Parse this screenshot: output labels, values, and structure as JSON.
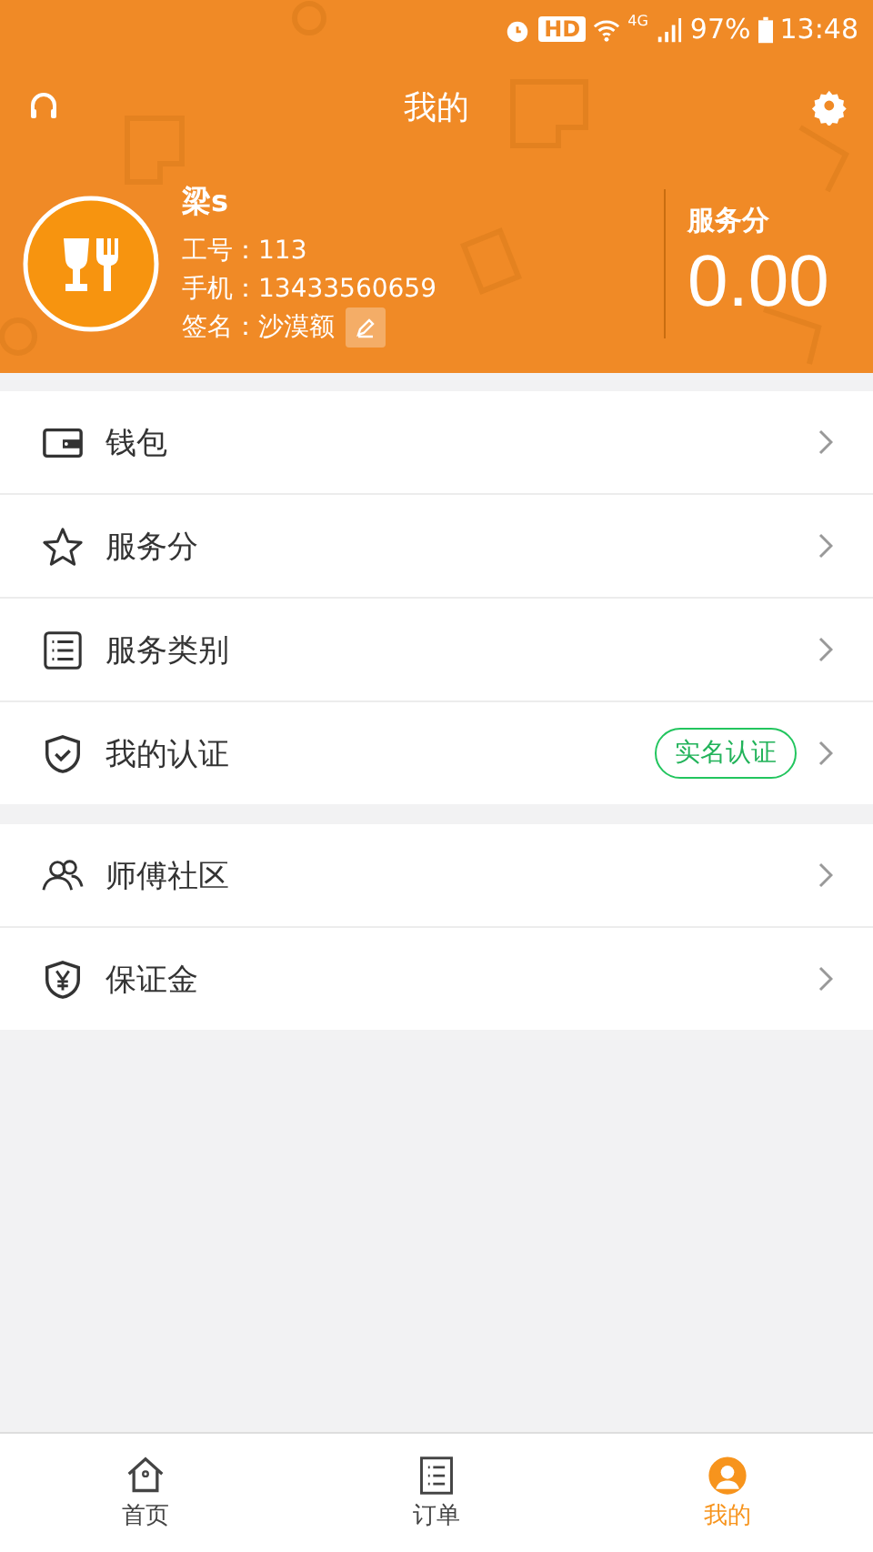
{
  "status_bar": {
    "hd": "HD",
    "network": "4G",
    "battery": "97%",
    "time": "13:48"
  },
  "header": {
    "title": "我的"
  },
  "profile": {
    "name": "梁s",
    "fields": [
      {
        "label": "工号：",
        "value": "113"
      },
      {
        "label": "手机：",
        "value": "13433560659"
      },
      {
        "label": "签名：",
        "value": "沙漠额"
      }
    ],
    "score_label": "服务分",
    "score": "0.00"
  },
  "menu_groups": [
    {
      "items": [
        {
          "label": "钱包"
        },
        {
          "label": "服务分"
        },
        {
          "label": "服务类别"
        },
        {
          "label": "我的认证",
          "badge": "实名认证"
        }
      ]
    },
    {
      "items": [
        {
          "label": "师傅社区"
        },
        {
          "label": "保证金"
        }
      ]
    }
  ],
  "tab_bar": [
    {
      "label": "首页",
      "selected": false
    },
    {
      "label": "订单",
      "selected": false
    },
    {
      "label": "我的",
      "selected": true
    }
  ]
}
